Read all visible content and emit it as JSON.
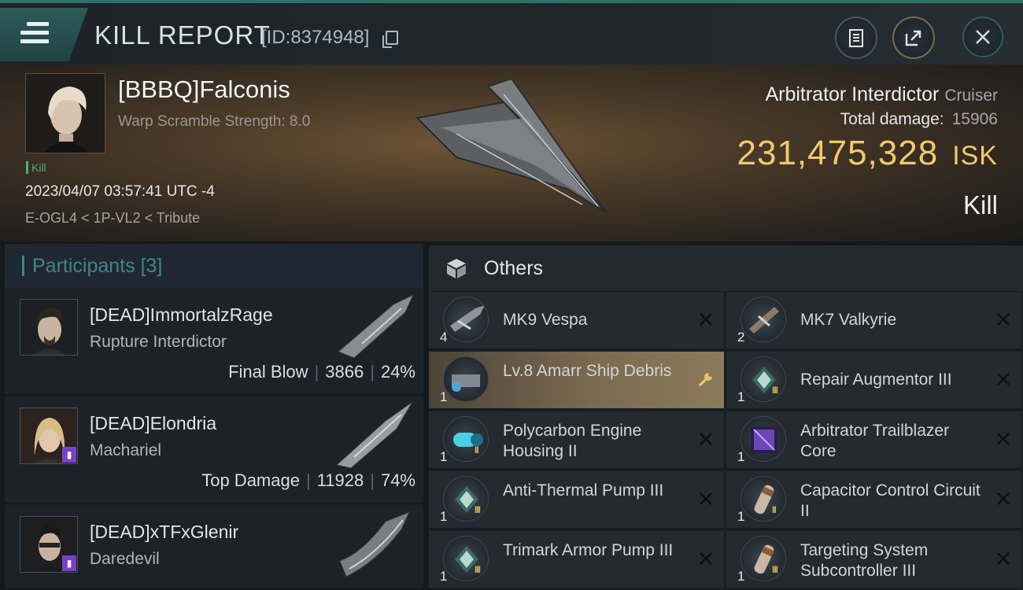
{
  "header": {
    "title": "KILL REPORT",
    "report_id": "[ID:8374948]"
  },
  "victim": {
    "name": "[BBBQ]Falconis",
    "warp_scramble": "Warp Scramble Strength: 8.0",
    "kill_tag": "Kill",
    "timestamp": "2023/04/07 03:57:41 UTC -4",
    "location": "E-OGL4 < 1P-VL2 < Tribute",
    "ship_name": "Arbitrator Interdictor",
    "ship_class": "Cruiser",
    "total_damage_label": "Total damage:",
    "total_damage_value": "15906",
    "isk_value": "231,475,328",
    "isk_unit": "ISK",
    "result": "Kill"
  },
  "participants": {
    "title": "Participants",
    "count": "[3]",
    "rows": [
      {
        "name": "[DEAD]ImmortalzRage",
        "ship": "Rupture Interdictor",
        "role": "Final Blow",
        "damage": "3866",
        "percent": "24%"
      },
      {
        "name": "[DEAD]Elondria",
        "ship": "Machariel",
        "role": "Top Damage",
        "damage": "11928",
        "percent": "74%"
      },
      {
        "name": "[DEAD]xTFxGlenir",
        "ship": "Daredevil",
        "role": "",
        "damage": "",
        "percent": ""
      }
    ]
  },
  "others": {
    "title": "Others",
    "items": [
      {
        "name": "MK9  Vespa",
        "qty": "4"
      },
      {
        "name": "MK7  Valkyrie",
        "qty": "2"
      },
      {
        "name": "Lv.8 Amarr Ship Debris",
        "qty": "1"
      },
      {
        "name": "Repair Augmentor III",
        "qty": "1"
      },
      {
        "name": "Polycarbon Engine Housing II",
        "qty": "1"
      },
      {
        "name": "Arbitrator Trailblazer Core",
        "qty": "1"
      },
      {
        "name": "Anti-Thermal Pump III",
        "qty": "1"
      },
      {
        "name": "Capacitor Control Circuit II",
        "qty": "1"
      },
      {
        "name": "Trimark Armor Pump III",
        "qty": "1"
      },
      {
        "name": "Targeting System Subcontroller III",
        "qty": "1"
      }
    ]
  },
  "colors": {
    "accent_teal": "#40848a",
    "isk_gold": "#f2c96d",
    "kill_green": "#4caf7a",
    "highlight_gold": "#8d7a5a"
  },
  "icons": {
    "menu": "hamburger-icon",
    "copy": "copy-icon",
    "clipboard": "clipboard-icon",
    "share": "share-icon",
    "close": "close-icon",
    "others": "cube-icon",
    "wrench": "wrench-icon",
    "remove": "x-icon"
  }
}
